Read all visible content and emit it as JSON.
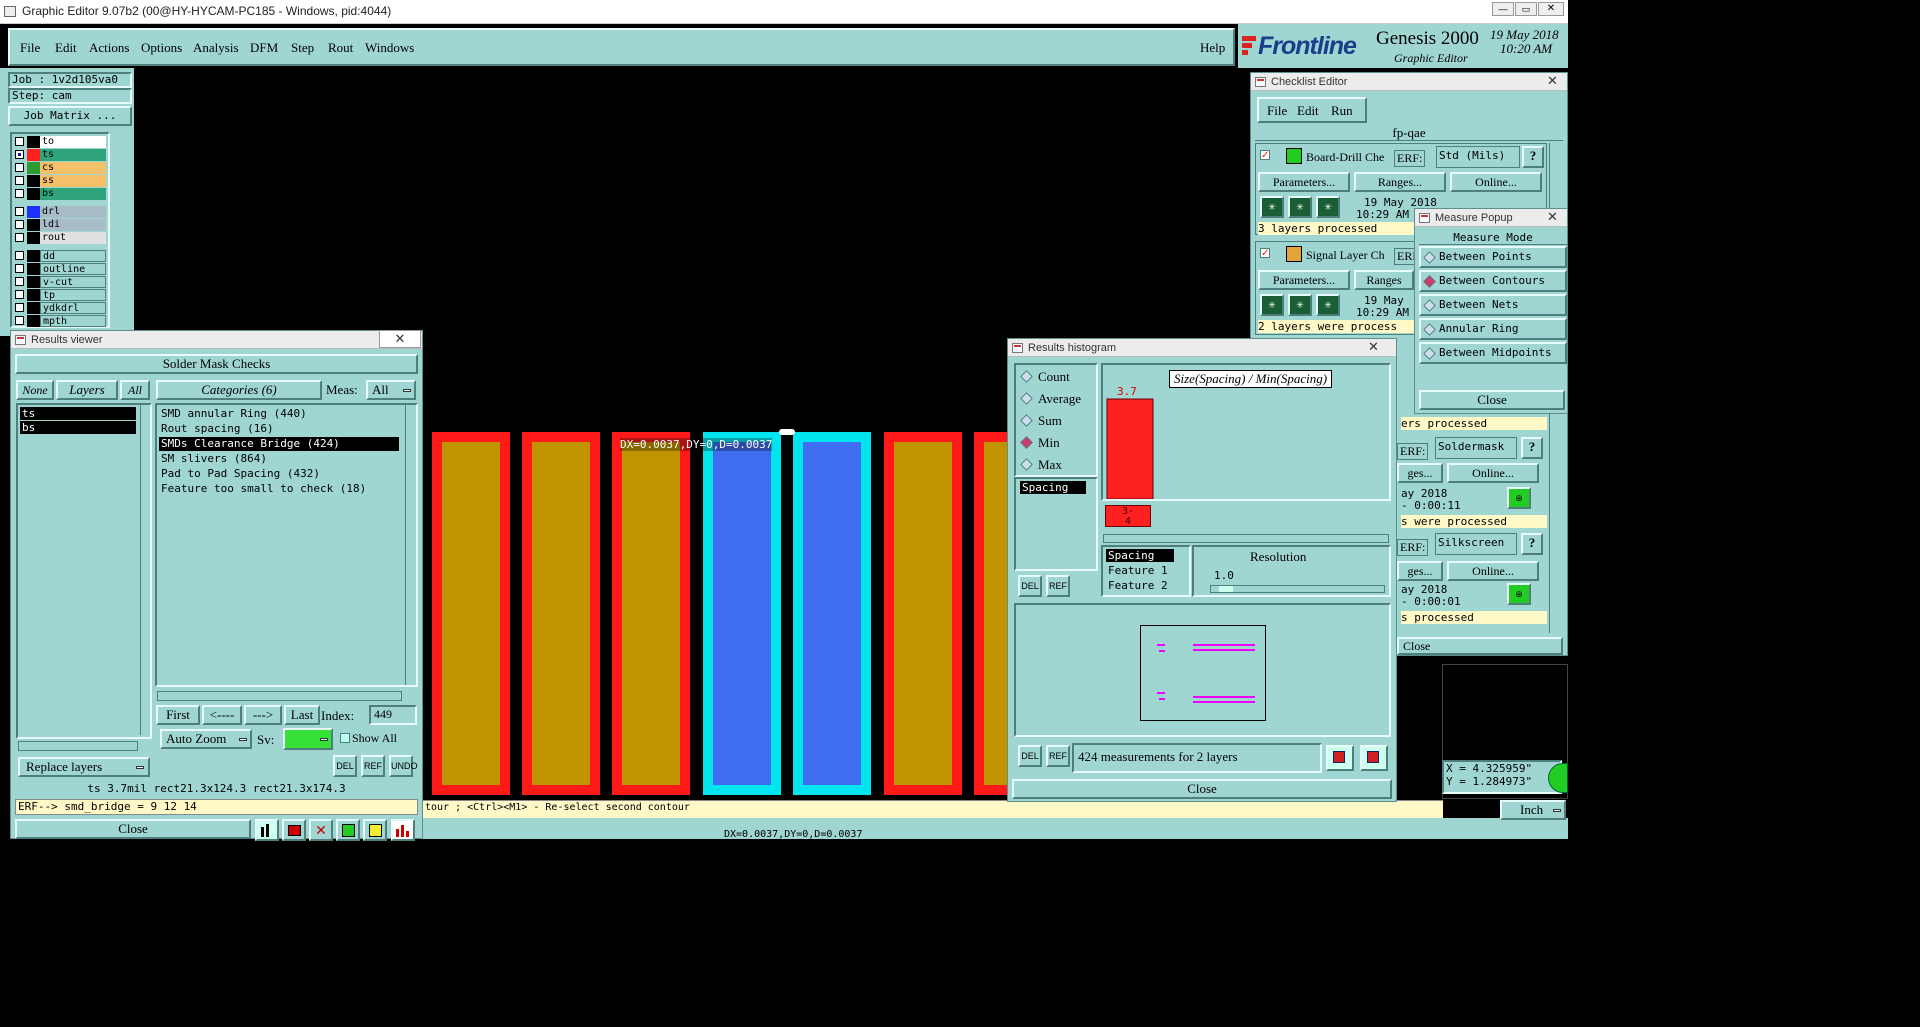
{
  "window": {
    "title": "Graphic Editor 9.07b2 (00@HY-HYCAM-PC185 - Windows, pid:4044)",
    "min": "—",
    "max": "▭",
    "close": "✕"
  },
  "menu": {
    "file": "File",
    "edit": "Edit",
    "actions": "Actions",
    "options": "Options",
    "analysis": "Analysis",
    "dfm": "DFM",
    "step": "Step",
    "rout": "Rout",
    "windows": "Windows",
    "help": "Help"
  },
  "brand": {
    "logo": "Frontline",
    "product": "Genesis 2000",
    "subtitle": "Graphic Editor",
    "date": "19 May 2018",
    "time": "10:20 AM"
  },
  "job": {
    "job_label": "Job : 1v2d105va0",
    "step_label": "Step: cam",
    "matrix_button": "Job Matrix ..."
  },
  "layers_top": [
    {
      "name": "to",
      "color": "#ffffff",
      "swatch": "#000000",
      "checked": false
    },
    {
      "name": "ts",
      "color": "#2fa37a",
      "swatch": "#ff2020",
      "checked": true
    },
    {
      "name": "cs",
      "color": "#f5c06a",
      "swatch": "#2f9a2f",
      "checked": false
    },
    {
      "name": "ss",
      "color": "#f5c06a",
      "swatch": "#000000",
      "checked": false
    },
    {
      "name": "bs",
      "color": "#2fa37a",
      "swatch": "#000000",
      "checked": false
    }
  ],
  "layers_mid": [
    {
      "name": "drl",
      "color": "#a8bcc8",
      "swatch": "#2030ff"
    },
    {
      "name": "ldi",
      "color": "#a8bcc8",
      "swatch": "#000000"
    },
    {
      "name": "rout",
      "color": "#e0e0e0",
      "swatch": "#000000"
    }
  ],
  "layers_low": [
    {
      "name": "dd",
      "color": "#9fd6d2"
    },
    {
      "name": "outline",
      "color": "#9fd6d2"
    },
    {
      "name": "v-cut",
      "color": "#9fd6d2"
    },
    {
      "name": "tp",
      "color": "#9fd6d2"
    },
    {
      "name": "ydkdrl",
      "color": "#9fd6d2"
    },
    {
      "name": "mpth",
      "color": "#9fd6d2"
    }
  ],
  "results_viewer": {
    "title": "Results viewer",
    "header": "Solder Mask Checks",
    "none_btn": "None",
    "layers_btn": "Layers",
    "all_btn": "All",
    "categories_btn": "Categories (6)",
    "meas_label": "Meas:",
    "meas_value": "All",
    "layers": [
      "ts",
      "bs"
    ],
    "categories": [
      "SMD annular Ring (440)",
      "Rout spacing (16)",
      "SMDs Clearance Bridge (424)",
      "SM slivers (864)",
      "Pad to Pad Spacing (432)",
      "Feature too small to check (18)"
    ],
    "first": "First",
    "prev": "<----",
    "next": "--->",
    "last": "Last",
    "index_label": "Index:",
    "index_value": "449",
    "autozoom": "Auto Zoom",
    "sv_label": "Sv:",
    "showall": "Show All",
    "replace": "Replace layers",
    "del": "DEL",
    "ref": "REF",
    "undo": "UNDO",
    "status1": "ts 3.7mil  rect21.3x124.3  rect21.3x174.3",
    "status2": "ERF--> smd_bridge = 9 12 14",
    "close": "Close"
  },
  "canvas": {
    "measure_text": "DX=0.0037,DY=0,D=0.0037",
    "prompt": "tour ; <Ctrl><M1> - Re-select second contour",
    "bottom_text": "DX=0.0037,DY=0,D=0.0037"
  },
  "histogram": {
    "title": "Results histogram",
    "modes": [
      "Count",
      "Average",
      "Sum",
      "Min",
      "Max"
    ],
    "selected_mode": "Min",
    "graph_title": "Size(Spacing) / Min(Spacing)",
    "bar_value": "3.7",
    "bin_label": "3-4",
    "list_item": "Spacing",
    "attrs": [
      "Spacing",
      "Feature 1",
      "Feature 2"
    ],
    "resolution_label": "Resolution",
    "resolution_value": "1.0",
    "del": "DEL",
    "ref": "REF",
    "summary": "424 measurements for 2 layers",
    "close": "Close"
  },
  "checklist": {
    "title": "Checklist Editor",
    "menu": {
      "file": "File",
      "edit": "Edit",
      "run": "Run"
    },
    "name": "fp-qae",
    "items": [
      {
        "name": "Board-Drill Che",
        "erf": "ERF:",
        "erf_value": "Std (Mils)",
        "params": "Parameters...",
        "ranges": "Ranges...",
        "online": "Online...",
        "date": "19 May 2018",
        "time": "10:29 AM -",
        "status": "3 layers processed"
      },
      {
        "name": "Signal Layer Ch",
        "erf": "ERF",
        "erf_value": "",
        "params": "Parameters...",
        "ranges": "Ranges",
        "online": "",
        "date": "19 May",
        "time": "10:29 AM -",
        "status": "2 layers were process"
      },
      {
        "name": "",
        "erf": "ERF:",
        "erf_value": "Soldermask",
        "params": "",
        "ranges": "ges...",
        "online": "Online...",
        "date": "ay 2018",
        "time": "- 0:00:11",
        "status": "s were processed",
        "status_above": "ers processed"
      },
      {
        "name": "",
        "erf": "ERF:",
        "erf_value": "Silkscreen",
        "params": "",
        "ranges": "ges...",
        "online": "Online...",
        "date": "ay 2018",
        "time": "- 0:00:01",
        "status": "s processed"
      }
    ],
    "close": "Close"
  },
  "measure": {
    "title": "Measure Popup",
    "header": "Measure Mode",
    "modes": [
      "Between Points",
      "Between Contours",
      "Between Nets",
      "Annular Ring",
      "Between Midpoints"
    ],
    "selected": "Between Contours",
    "close": "Close"
  },
  "coords": {
    "x": "X = 4.325959\"",
    "y": "Y = 1.284973\"",
    "units": "Inch"
  }
}
